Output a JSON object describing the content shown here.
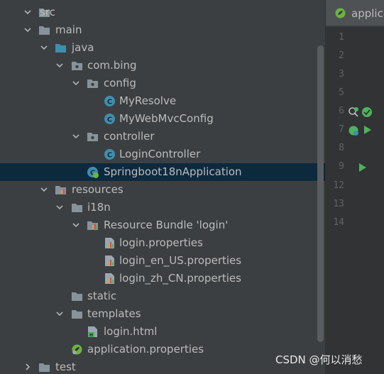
{
  "project_tree": {
    "nodes": [
      {
        "label": "src",
        "icon": "folder-icon"
      },
      {
        "label": "main",
        "icon": "folder-icon"
      },
      {
        "label": "java",
        "icon": "source-folder-icon"
      },
      {
        "label": "com.bing",
        "icon": "package-icon"
      },
      {
        "label": "config",
        "icon": "package-icon"
      },
      {
        "label": "MyResolve",
        "icon": "class-icon"
      },
      {
        "label": "MyWebMvcConfig",
        "icon": "class-icon"
      },
      {
        "label": "controller",
        "icon": "package-icon"
      },
      {
        "label": "LoginController",
        "icon": "class-icon"
      },
      {
        "label": "Springboot18nApplication",
        "icon": "spring-boot-class-icon",
        "selected": true
      },
      {
        "label": "resources",
        "icon": "resources-folder-icon"
      },
      {
        "label": "i18n",
        "icon": "folder-icon"
      },
      {
        "label": "Resource Bundle 'login'",
        "icon": "resource-bundle-icon"
      },
      {
        "label": "login.properties",
        "icon": "properties-file-icon"
      },
      {
        "label": "login_en_US.properties",
        "icon": "properties-file-icon"
      },
      {
        "label": "login_zh_CN.properties",
        "icon": "properties-file-icon"
      },
      {
        "label": "static",
        "icon": "folder-icon"
      },
      {
        "label": "templates",
        "icon": "folder-icon"
      },
      {
        "label": "login.html",
        "icon": "html-file-icon"
      },
      {
        "label": "application.properties",
        "icon": "spring-properties-icon"
      },
      {
        "label": "test",
        "icon": "folder-icon"
      }
    ]
  },
  "editor": {
    "tab_label": "applica",
    "line_numbers": [
      "1",
      "2",
      "3",
      "5",
      "6",
      "7",
      "8",
      "9",
      "12",
      "13",
      "14"
    ]
  },
  "watermark": "CSDN @何以消愁",
  "colors": {
    "background": "#3c3f41",
    "selection": "#0d293e",
    "gutter": "#313335",
    "class_icon": "#3d8fb0",
    "run_green": "#4eb35b"
  }
}
